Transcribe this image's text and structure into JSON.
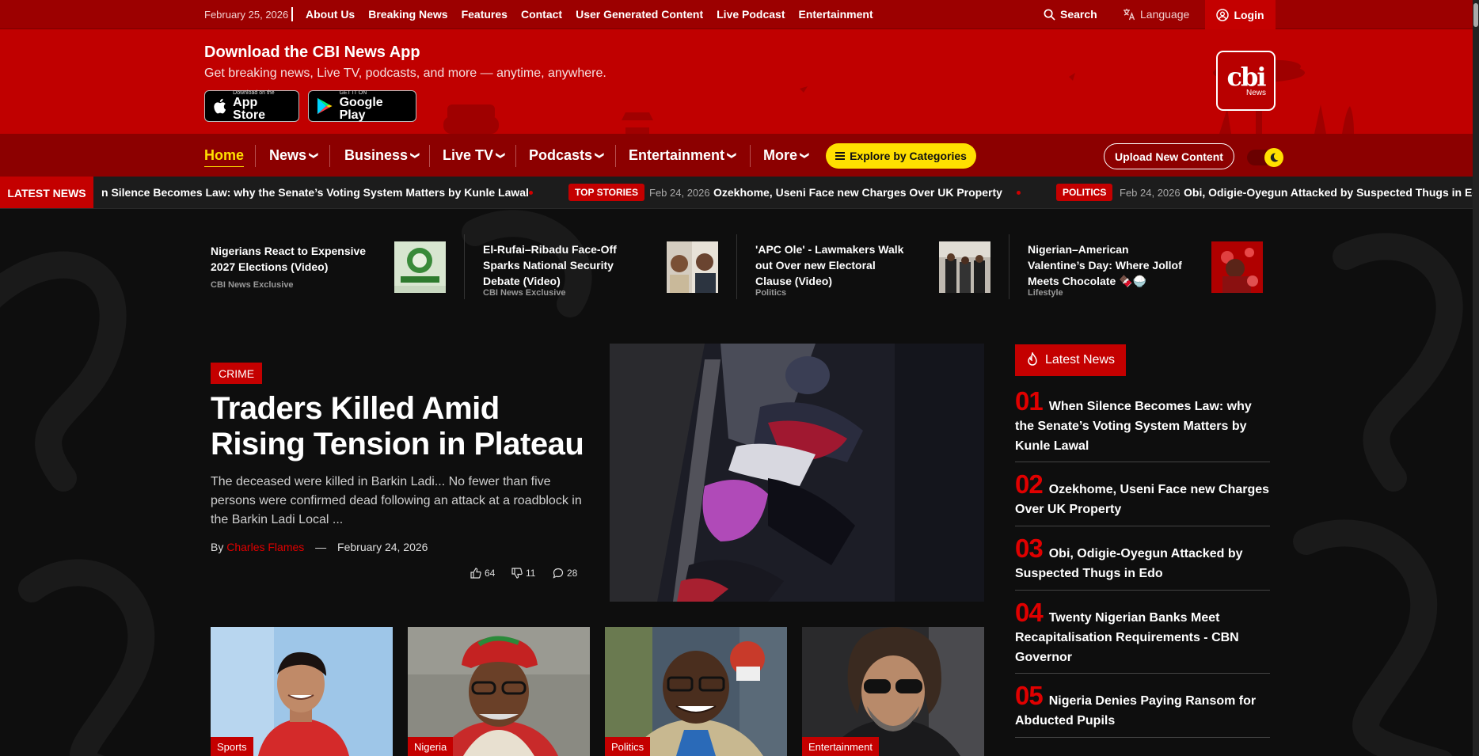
{
  "topbar": {
    "date": "February 25, 2026",
    "links": [
      "About Us",
      "Breaking News",
      "Features",
      "Contact",
      "User Generated Content",
      "Live Podcast",
      "Entertainment"
    ],
    "search": "Search",
    "language": "Language",
    "login": "Login"
  },
  "banner": {
    "title": "Download the CBI News App",
    "subtitle": "Get breaking news, Live TV, podcasts, and more — anytime, anywhere.",
    "appstore_small": "Download on the",
    "appstore_big": "App Store",
    "googleplay_small": "GET IT ON",
    "googleplay_big": "Google Play",
    "logo_main": "cbi",
    "logo_sub": "News"
  },
  "nav": {
    "home": "Home",
    "news": "News",
    "business": "Business",
    "livetv": "Live TV",
    "podcasts": "Podcasts",
    "entertainment": "Entertainment",
    "more": "More",
    "explore": "Explore by Categories",
    "upload": "Upload New Content"
  },
  "ticker": {
    "label": "LATEST NEWS",
    "item1": "n Silence Becomes Law: why the Senate’s Voting System Matters by Kunle Lawal",
    "badge2": "TOP STORIES",
    "date2": "Feb 24, 2026",
    "item2": "Ozekhome, Useni Face new Charges Over UK Property",
    "badge3": "POLITICS",
    "date3": "Feb 24, 2026",
    "item3": "Obi, Odigie-Oyegun Attacked by Suspected Thugs in Edo"
  },
  "top_stories": [
    {
      "title": "Nigerians React to Expensive 2027 Elections (Video)",
      "category": "CBI News Exclusive"
    },
    {
      "title": "El-Rufai–Ribadu Face-Off Sparks National Security Debate (Video)",
      "category": "CBI News Exclusive"
    },
    {
      "title": "'APC Ole' - Lawmakers Walk out Over new Electoral Clause (Video)",
      "category": "Politics"
    },
    {
      "title": "Nigerian–American Valentine’s Day: Where Jollof Meets Chocolate 🍫🍚",
      "category": "Lifestyle"
    }
  ],
  "featured": {
    "category": "CRIME",
    "title": "Traders Killed Amid Rising Tension in Plateau",
    "description": "The deceased were killed in Barkin Ladi... No fewer than five persons were confirmed dead following an attack at a roadblock in the Barkin Ladi Local ...",
    "by": "By",
    "author": "Charles Flames",
    "dash": "—",
    "date": "February 24, 2026",
    "likes": "64",
    "dislikes": "11",
    "comments": "28"
  },
  "cards": [
    {
      "category": "Sports"
    },
    {
      "category": "Nigeria"
    },
    {
      "category": "Politics"
    },
    {
      "category": "Entertainment"
    }
  ],
  "latest": {
    "heading": "Latest News",
    "items": [
      {
        "num": "01",
        "title": "When Silence Becomes Law: why the Senate’s Voting System Matters by Kunle Lawal"
      },
      {
        "num": "02",
        "title": "Ozekhome, Useni Face new Charges Over UK Property"
      },
      {
        "num": "03",
        "title": "Obi, Odigie-Oyegun Attacked by Suspected Thugs in Edo"
      },
      {
        "num": "04",
        "title": "Twenty Nigerian Banks Meet Recapitalisation Requirements - CBN Governor"
      },
      {
        "num": "05",
        "title": "Nigeria Denies Paying Ransom for Abducted Pupils"
      }
    ]
  },
  "colors": {
    "brand_red": "#c40000",
    "dark_red": "#8c0000",
    "accent_yellow": "#ffe000",
    "bg": "#0e0e0e"
  }
}
